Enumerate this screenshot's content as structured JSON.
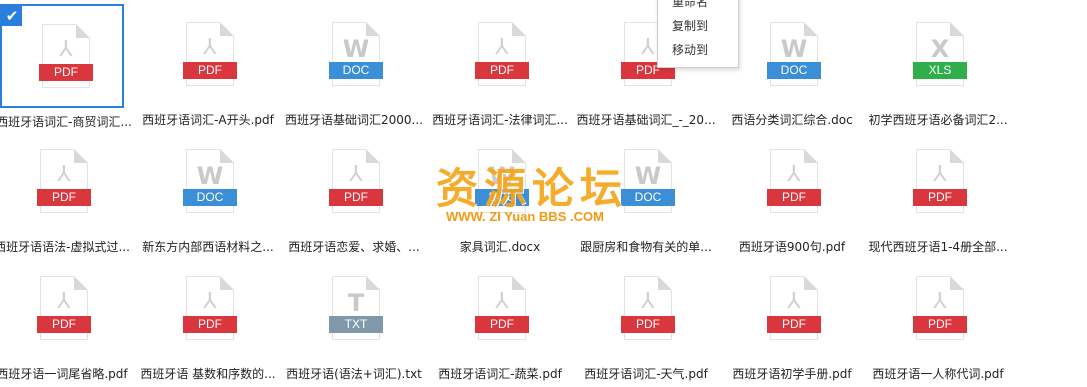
{
  "files": [
    {
      "name": "西班牙语词汇-商贸词汇...",
      "type": "PDF",
      "selected": true
    },
    {
      "name": "西班牙语词汇-A开头.pdf",
      "type": "PDF"
    },
    {
      "name": "西班牙语基础词汇2000...",
      "type": "DOC"
    },
    {
      "name": "西班牙语词汇-法律词汇...",
      "type": "PDF"
    },
    {
      "name": "西班牙语基础词汇_-_20...",
      "type": "PDF"
    },
    {
      "name": "西语分类词汇综合.doc",
      "type": "DOC"
    },
    {
      "name": "初学西班牙语必备词汇2...",
      "type": "XLS"
    },
    {
      "name": "西班牙语语法-虚拟式过...",
      "type": "PDF"
    },
    {
      "name": "新东方内部西语材料之...",
      "type": "DOC"
    },
    {
      "name": "西班牙语恋爱、求婚、...",
      "type": "PDF"
    },
    {
      "name": "家具词汇.docx",
      "type": "DOC"
    },
    {
      "name": "跟厨房和食物有关的单...",
      "type": "DOC"
    },
    {
      "name": "西班牙语900句.pdf",
      "type": "PDF"
    },
    {
      "name": "现代西班牙语1-4册全部...",
      "type": "PDF"
    },
    {
      "name": "西班牙语一词尾省略.pdf",
      "type": "PDF"
    },
    {
      "name": "西班牙语 基数和序数的...",
      "type": "PDF"
    },
    {
      "name": "西班牙语(语法+词汇).txt",
      "type": "TXT"
    },
    {
      "name": "西班牙语词汇-蔬菜.pdf",
      "type": "PDF"
    },
    {
      "name": "西班牙语词汇-天气.pdf",
      "type": "PDF"
    },
    {
      "name": "西班牙语初学手册.pdf",
      "type": "PDF"
    },
    {
      "name": "西班牙语一人称代词.pdf",
      "type": "PDF"
    }
  ],
  "type_styles": {
    "PDF": {
      "color": "#d9363e",
      "icon": "pdf-acrobat-icon",
      "glyph": "⅄"
    },
    "DOC": {
      "color": "#3a8fd6",
      "icon": "word-document-icon",
      "glyph": "W"
    },
    "XLS": {
      "color": "#2fae4a",
      "icon": "excel-spreadsheet-icon",
      "glyph": "X"
    },
    "TXT": {
      "color": "#7f98ab",
      "icon": "text-file-icon",
      "glyph": "T"
    }
  },
  "context_menu": {
    "items": [
      "重命名",
      "复制到",
      "移动到"
    ]
  },
  "watermark": {
    "title": "资源论坛",
    "url": "WWW. ZI Yuan BBS .COM"
  }
}
